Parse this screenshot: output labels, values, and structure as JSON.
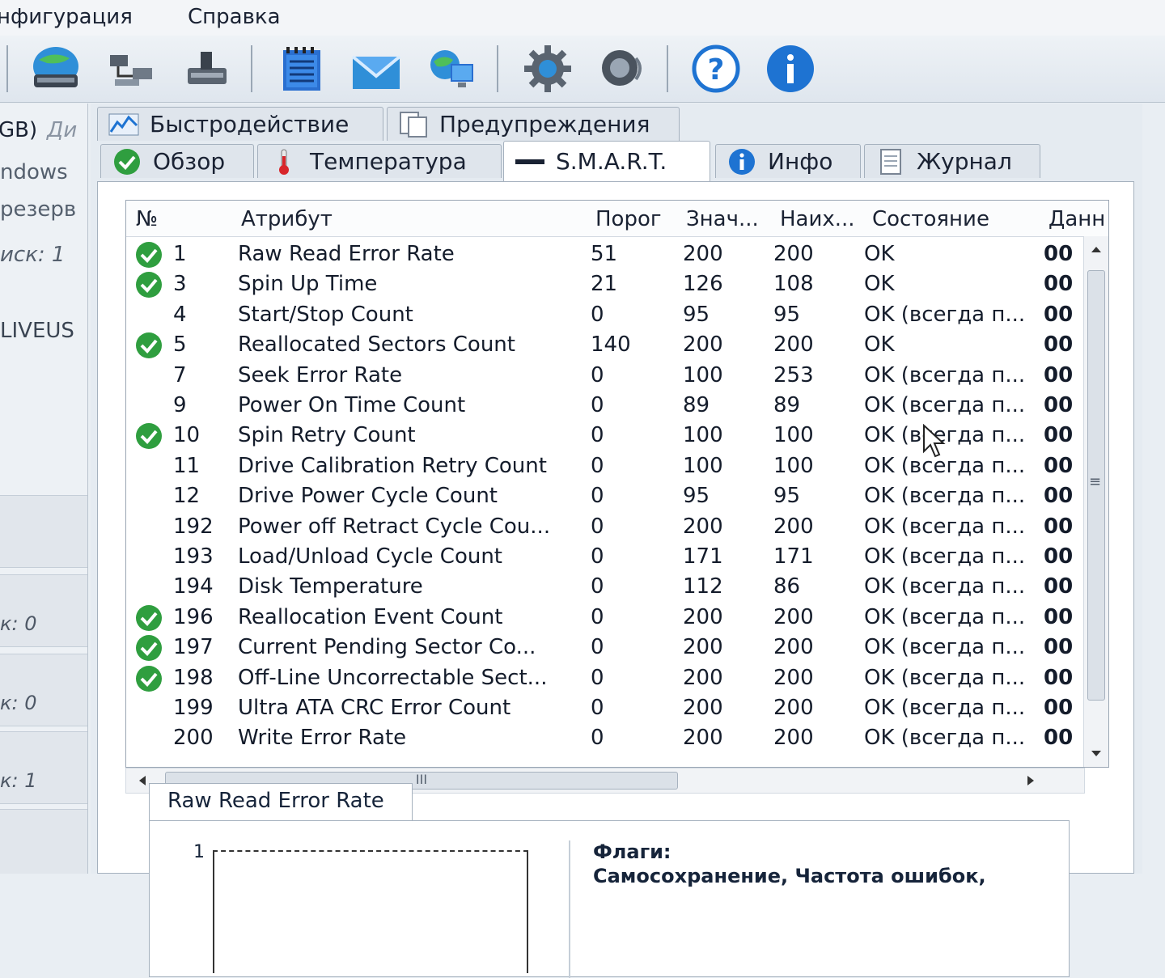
{
  "menu": {
    "items": [
      "нфигурация",
      "Справка"
    ]
  },
  "toolbar": {
    "icons": [
      "globe-drive-icon",
      "network-icon",
      "scan-drive-icon",
      "notepad-icon",
      "mail-icon",
      "globe-monitor-icon",
      "gear-icon",
      "speaker-icon",
      "help-icon",
      "info-icon"
    ]
  },
  "left_panel": {
    "labels": [
      "GB)",
      "Ди",
      "ndows",
      "резерв",
      "иск: 1",
      "LIVEUS"
    ],
    "cards": [
      "к: 0",
      "к: 0",
      "к: 1"
    ]
  },
  "tabs": {
    "row1": [
      "Быстродействие",
      "Предупреждения"
    ],
    "row2": [
      "Обзор",
      "Температура",
      "S.M.A.R.T.",
      "Инфо",
      "Журнал"
    ]
  },
  "table": {
    "headers": [
      "№",
      "Атрибут",
      "Порог",
      "Знач...",
      "Наих...",
      "Состояние",
      "Данн"
    ],
    "rows": [
      {
        "id": "1",
        "attr": "Raw Read Error Rate",
        "thr": "51",
        "val": "200",
        "worst": "200",
        "state": "OK",
        "data": "00",
        "check": true
      },
      {
        "id": "3",
        "attr": "Spin Up Time",
        "thr": "21",
        "val": "126",
        "worst": "108",
        "state": "OK",
        "data": "00",
        "check": true
      },
      {
        "id": "4",
        "attr": "Start/Stop Count",
        "thr": "0",
        "val": "95",
        "worst": "95",
        "state": "OK (всегда п...",
        "data": "00",
        "check": false
      },
      {
        "id": "5",
        "attr": "Reallocated Sectors Count",
        "thr": "140",
        "val": "200",
        "worst": "200",
        "state": "OK",
        "data": "00",
        "check": true
      },
      {
        "id": "7",
        "attr": "Seek Error Rate",
        "thr": "0",
        "val": "100",
        "worst": "253",
        "state": "OK (всегда п...",
        "data": "00",
        "check": false
      },
      {
        "id": "9",
        "attr": "Power On Time Count",
        "thr": "0",
        "val": "89",
        "worst": "89",
        "state": "OK (всегда п...",
        "data": "00",
        "check": false
      },
      {
        "id": "10",
        "attr": "Spin Retry Count",
        "thr": "0",
        "val": "100",
        "worst": "100",
        "state": "OK (всегда п...",
        "data": "00",
        "check": true
      },
      {
        "id": "11",
        "attr": "Drive Calibration Retry Count",
        "thr": "0",
        "val": "100",
        "worst": "100",
        "state": "OK (всегда п...",
        "data": "00",
        "check": false
      },
      {
        "id": "12",
        "attr": "Drive Power Cycle Count",
        "thr": "0",
        "val": "95",
        "worst": "95",
        "state": "OK (всегда п...",
        "data": "00",
        "check": false
      },
      {
        "id": "192",
        "attr": "Power off Retract Cycle Cou...",
        "thr": "0",
        "val": "200",
        "worst": "200",
        "state": "OK (всегда п...",
        "data": "00",
        "check": false
      },
      {
        "id": "193",
        "attr": "Load/Unload Cycle Count",
        "thr": "0",
        "val": "171",
        "worst": "171",
        "state": "OK (всегда п...",
        "data": "00",
        "check": false
      },
      {
        "id": "194",
        "attr": "Disk Temperature",
        "thr": "0",
        "val": "112",
        "worst": "86",
        "state": "OK (всегда п...",
        "data": "00",
        "check": false
      },
      {
        "id": "196",
        "attr": "Reallocation Event Count",
        "thr": "0",
        "val": "200",
        "worst": "200",
        "state": "OK (всегда п...",
        "data": "00",
        "check": true
      },
      {
        "id": "197",
        "attr": "Current Pending Sector Co...",
        "thr": "0",
        "val": "200",
        "worst": "200",
        "state": "OK (всегда п...",
        "data": "00",
        "check": true
      },
      {
        "id": "198",
        "attr": "Off-Line Uncorrectable Sect...",
        "thr": "0",
        "val": "200",
        "worst": "200",
        "state": "OK (всегда п...",
        "data": "00",
        "check": true
      },
      {
        "id": "199",
        "attr": "Ultra ATA CRC Error Count",
        "thr": "0",
        "val": "200",
        "worst": "200",
        "state": "OK (всегда п...",
        "data": "00",
        "check": false
      },
      {
        "id": "200",
        "attr": "Write Error Rate",
        "thr": "0",
        "val": "200",
        "worst": "200",
        "state": "OK (всегда п...",
        "data": "00",
        "check": false
      }
    ]
  },
  "scroll": {
    "hthumb_glyph": "III",
    "vthumb_glyph": "≡"
  },
  "detail": {
    "tab_label": "Raw Read Error Rate",
    "graph_label": "1",
    "flags_title": "Флаги:",
    "flags_text": "Самосохранение, Частота ошибок,"
  },
  "colors": {
    "check": "#2f9e3f",
    "info": "#1e73d2",
    "accent": "#1a2233"
  }
}
